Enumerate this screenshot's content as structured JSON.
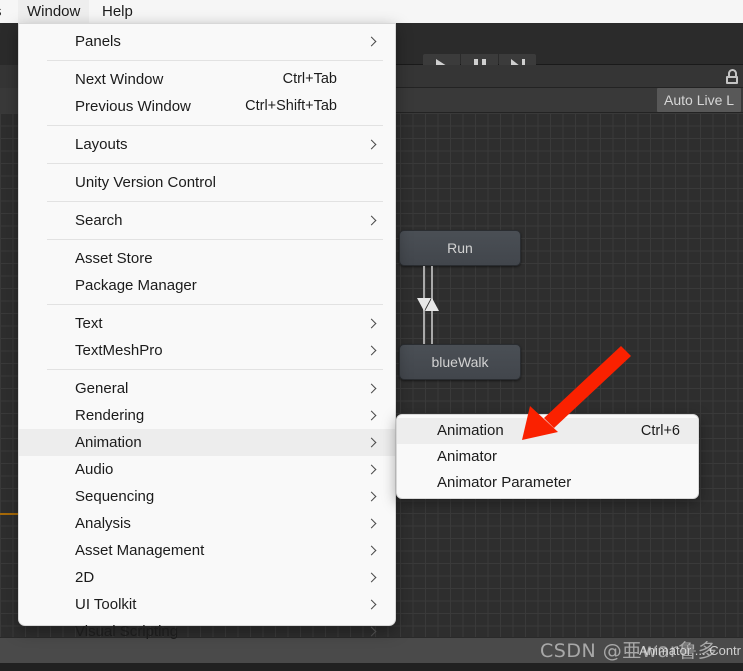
{
  "app": {
    "title": "Unity Editor",
    "accent_red": "#fa2100",
    "menu_bg": "#f9f9f9",
    "highlight_bg": "#ededed"
  },
  "menubar": {
    "truncated_left_label": "s",
    "items": [
      {
        "label": "Window",
        "active": true
      },
      {
        "label": "Help",
        "active": false
      }
    ]
  },
  "toolbar": {
    "play_icon": "play-icon",
    "pause_icon": "pause-icon",
    "step_icon": "step-icon",
    "lock_icon": "lock-icon",
    "auto_live_link_label": "Auto Live L"
  },
  "window_menu": {
    "groups": [
      {
        "items": [
          {
            "label": "Panels",
            "shortcut": "",
            "submenu": true,
            "highlight": false
          }
        ]
      },
      {
        "items": [
          {
            "label": "Next Window",
            "shortcut": "Ctrl+Tab",
            "submenu": false,
            "highlight": false
          },
          {
            "label": "Previous Window",
            "shortcut": "Ctrl+Shift+Tab",
            "submenu": false,
            "highlight": false
          }
        ]
      },
      {
        "items": [
          {
            "label": "Layouts",
            "shortcut": "",
            "submenu": true,
            "highlight": false
          }
        ]
      },
      {
        "items": [
          {
            "label": "Unity Version Control",
            "shortcut": "",
            "submenu": false,
            "highlight": false
          }
        ]
      },
      {
        "items": [
          {
            "label": "Search",
            "shortcut": "",
            "submenu": true,
            "highlight": false
          }
        ]
      },
      {
        "items": [
          {
            "label": "Asset Store",
            "shortcut": "",
            "submenu": false,
            "highlight": false
          },
          {
            "label": "Package Manager",
            "shortcut": "",
            "submenu": false,
            "highlight": false
          }
        ]
      },
      {
        "items": [
          {
            "label": "Text",
            "shortcut": "",
            "submenu": true,
            "highlight": false
          },
          {
            "label": "TextMeshPro",
            "shortcut": "",
            "submenu": true,
            "highlight": false
          }
        ]
      },
      {
        "items": [
          {
            "label": "General",
            "shortcut": "",
            "submenu": true,
            "highlight": false
          },
          {
            "label": "Rendering",
            "shortcut": "",
            "submenu": true,
            "highlight": false
          },
          {
            "label": "Animation",
            "shortcut": "",
            "submenu": true,
            "highlight": true
          },
          {
            "label": "Audio",
            "shortcut": "",
            "submenu": true,
            "highlight": false
          },
          {
            "label": "Sequencing",
            "shortcut": "",
            "submenu": true,
            "highlight": false
          },
          {
            "label": "Analysis",
            "shortcut": "",
            "submenu": true,
            "highlight": false
          },
          {
            "label": "Asset Management",
            "shortcut": "",
            "submenu": true,
            "highlight": false
          },
          {
            "label": "2D",
            "shortcut": "",
            "submenu": true,
            "highlight": false
          },
          {
            "label": "UI Toolkit",
            "shortcut": "",
            "submenu": true,
            "highlight": false
          },
          {
            "label": "Visual Scripting",
            "shortcut": "",
            "submenu": true,
            "highlight": false
          }
        ]
      }
    ]
  },
  "animation_submenu": {
    "items": [
      {
        "label": "Animation",
        "shortcut": "Ctrl+6",
        "highlight": true
      },
      {
        "label": "Animator",
        "shortcut": "",
        "highlight": false
      },
      {
        "label": "Animator Parameter",
        "shortcut": "",
        "highlight": false
      }
    ]
  },
  "animator_graph": {
    "states": [
      {
        "name": "Run"
      },
      {
        "name": "blueWalk"
      }
    ],
    "transition_arrows": [
      "arrow-down-icon",
      "arrow-up-icon"
    ]
  },
  "statusbar": {
    "text": "Animator ... Contr"
  },
  "watermark": {
    "text": "CSDN @亜war鲁多"
  }
}
